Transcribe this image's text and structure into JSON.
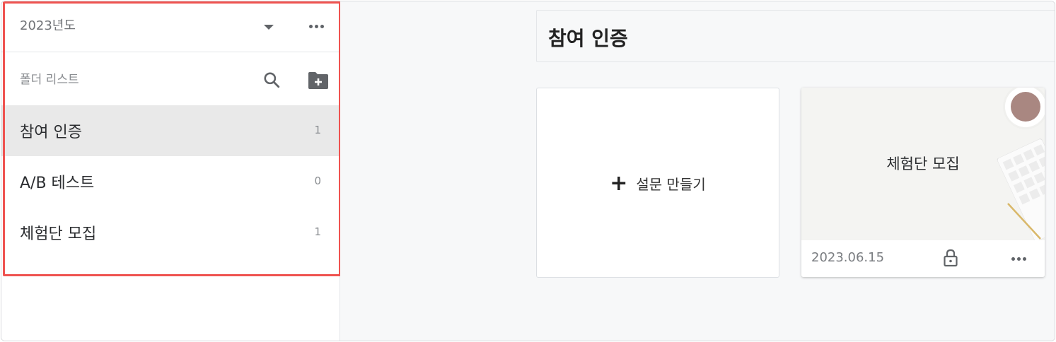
{
  "sidebar": {
    "year": "2023년도",
    "folder_list_label": "폴더 리스트",
    "items": [
      {
        "label": "참여 인증",
        "count": "1"
      },
      {
        "label": "A/B 테스트",
        "count": "0"
      },
      {
        "label": "체험단 모집",
        "count": "1"
      }
    ]
  },
  "main": {
    "title": "참여 인증",
    "create_label": "설문 만들기",
    "card": {
      "title": "체험단 모집",
      "date": "2023.06.15"
    }
  },
  "icons": {
    "year_dropdown": "caret-down-icon",
    "year_more": "more-horizontal-icon",
    "search": "search-icon",
    "add_folder": "folder-add-icon",
    "create": "plus-icon",
    "lock": "lock-icon",
    "card_more": "more-horizontal-icon"
  },
  "colors": {
    "highlight_border": "#ef5350",
    "active_item_bg": "#e9e9e9",
    "main_bg": "#f7f8f9"
  }
}
